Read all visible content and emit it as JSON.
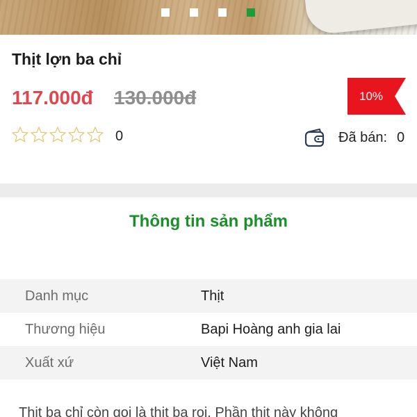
{
  "carousel": {
    "slide_count": 4,
    "active_index": 3
  },
  "product": {
    "name": "Thịt lợn ba chỉ",
    "price": "117.000đ",
    "original_price": "130.000đ",
    "discount": "10%",
    "rating_count": "0",
    "rating_stars": 0,
    "rating_max": 5,
    "sold_prefix": "Đã bán:",
    "sold_value": "0"
  },
  "info": {
    "title": "Thông tin sản phẩm",
    "rows": [
      {
        "label": "Danh mục",
        "value": "Thịt"
      },
      {
        "label": "Thương hiệu",
        "value": "Bapi Hoàng anh gia lai"
      },
      {
        "label": "Xuất xứ",
        "value": "Việt Nam"
      }
    ],
    "description": "Thịt ba chỉ còn gọi là thịt ba rọi. Phần thịt này không"
  },
  "colors": {
    "price": "#e0464f",
    "discount_badge": "#e8141e",
    "accent_green": "#1a8f2a",
    "star_outline": "#e0c060"
  },
  "icons": {
    "wallet": "wallet-icon",
    "star": "star-outline-icon"
  }
}
